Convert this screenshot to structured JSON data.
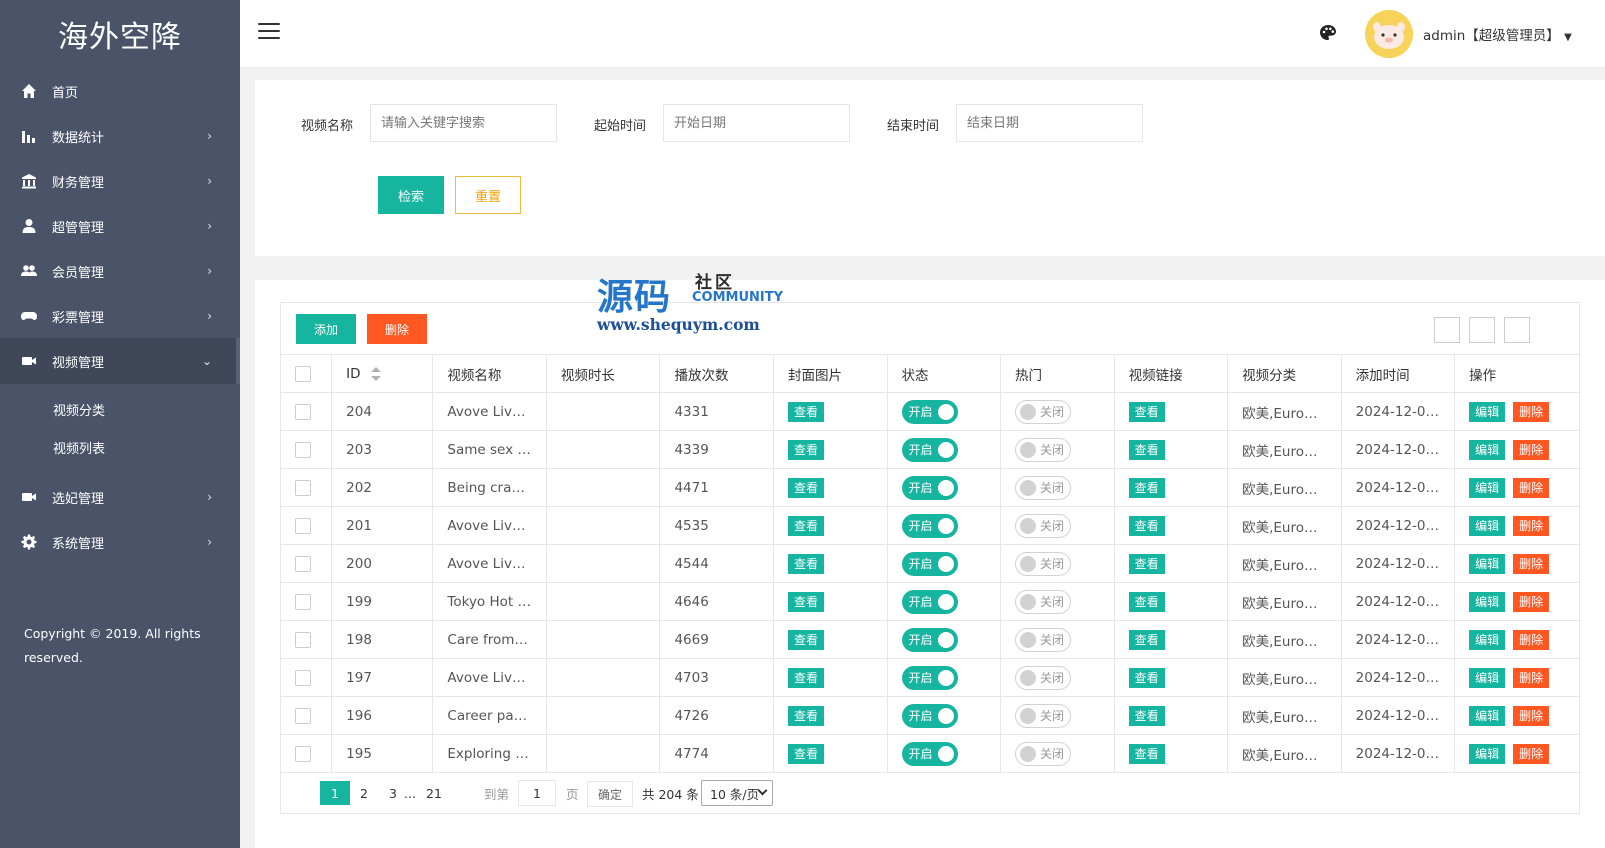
{
  "app": {
    "logo": "海外空降",
    "copyright": "Copyright © 2019. All rights reserved."
  },
  "sidebar": {
    "items": [
      {
        "label": "首页",
        "icon": "home-icon",
        "has_arrow": false
      },
      {
        "label": "数据统计",
        "icon": "bar-chart-icon",
        "has_arrow": true
      },
      {
        "label": "财务管理",
        "icon": "bank-icon",
        "has_arrow": true
      },
      {
        "label": "超管管理",
        "icon": "user-icon",
        "has_arrow": true
      },
      {
        "label": "会员管理",
        "icon": "users-icon",
        "has_arrow": true
      },
      {
        "label": "彩票管理",
        "icon": "gamepad-icon",
        "has_arrow": true
      },
      {
        "label": "视频管理",
        "icon": "video-icon",
        "has_arrow": true,
        "expanded": true
      },
      {
        "label": "选妃管理",
        "icon": "video-icon",
        "has_arrow": true
      },
      {
        "label": "系统管理",
        "icon": "gear-icon",
        "has_arrow": true
      }
    ],
    "sub_items": [
      "视频分类",
      "视频列表"
    ]
  },
  "header": {
    "user": "admin【超级管理员】"
  },
  "search": {
    "name_label": "视频名称",
    "name_placeholder": "请输入关键字搜索",
    "start_label": "起始时间",
    "start_placeholder": "开始日期",
    "end_label": "结束时间",
    "end_placeholder": "结束日期",
    "search_button": "检索",
    "reset_button": "重置"
  },
  "toolbar": {
    "add_label": "添加",
    "delete_label": "删除"
  },
  "watermark": {
    "big": "源码",
    "cn": "社区",
    "en": "COMMUNITY",
    "url": "www.shequym.com"
  },
  "table": {
    "columns": [
      "ID",
      "视频名称",
      "视频时长",
      "播放次数",
      "封面图片",
      "状态",
      "热门",
      "视频链接",
      "视频分类",
      "添加时间",
      "操作"
    ],
    "view_label": "查看",
    "on_label": "开启",
    "off_label": "关闭",
    "edit_label": "编辑",
    "remove_label": "删除",
    "rows": [
      {
        "id": "204",
        "name": "Avove Live…",
        "duration": "",
        "plays": "4331",
        "category": "欧美,Euro…",
        "time": "2024-12-0…"
      },
      {
        "id": "203",
        "name": "Same sex …",
        "duration": "",
        "plays": "4339",
        "category": "欧美,Euro…",
        "time": "2024-12-0…"
      },
      {
        "id": "202",
        "name": "Being craz…",
        "duration": "",
        "plays": "4471",
        "category": "欧美,Euro…",
        "time": "2024-12-0…"
      },
      {
        "id": "201",
        "name": "Avove Live…",
        "duration": "",
        "plays": "4535",
        "category": "欧美,Euro…",
        "time": "2024-12-0…"
      },
      {
        "id": "200",
        "name": "Avove Live…",
        "duration": "",
        "plays": "4544",
        "category": "欧美,Euro…",
        "time": "2024-12-0…"
      },
      {
        "id": "199",
        "name": "Tokyo Hot …",
        "duration": "",
        "plays": "4646",
        "category": "欧美,Euro…",
        "time": "2024-12-0…"
      },
      {
        "id": "198",
        "name": "Care from …",
        "duration": "",
        "plays": "4669",
        "category": "欧美,Euro…",
        "time": "2024-12-0…"
      },
      {
        "id": "197",
        "name": "Avove Live…",
        "duration": "",
        "plays": "4703",
        "category": "欧美,Euro…",
        "time": "2024-12-0…"
      },
      {
        "id": "196",
        "name": "Career par…",
        "duration": "",
        "plays": "4726",
        "category": "欧美,Euro…",
        "time": "2024-12-0…"
      },
      {
        "id": "195",
        "name": "Exploring f…",
        "duration": "",
        "plays": "4774",
        "category": "欧美,Euro…",
        "time": "2024-12-0…"
      }
    ]
  },
  "pagination": {
    "current": "1",
    "p2": "2",
    "p3": "3",
    "ellipsis": "…",
    "last": "21",
    "goto_label": "到第",
    "goto_value": "1",
    "page_label": "页",
    "confirm": "确定",
    "total": "共 204 条",
    "per_page": "10 条/页"
  },
  "colors": {
    "sidebar_bg": "#4a5368",
    "primary": "#16b5a0",
    "danger": "#ff5722",
    "warning": "#f1a400"
  }
}
